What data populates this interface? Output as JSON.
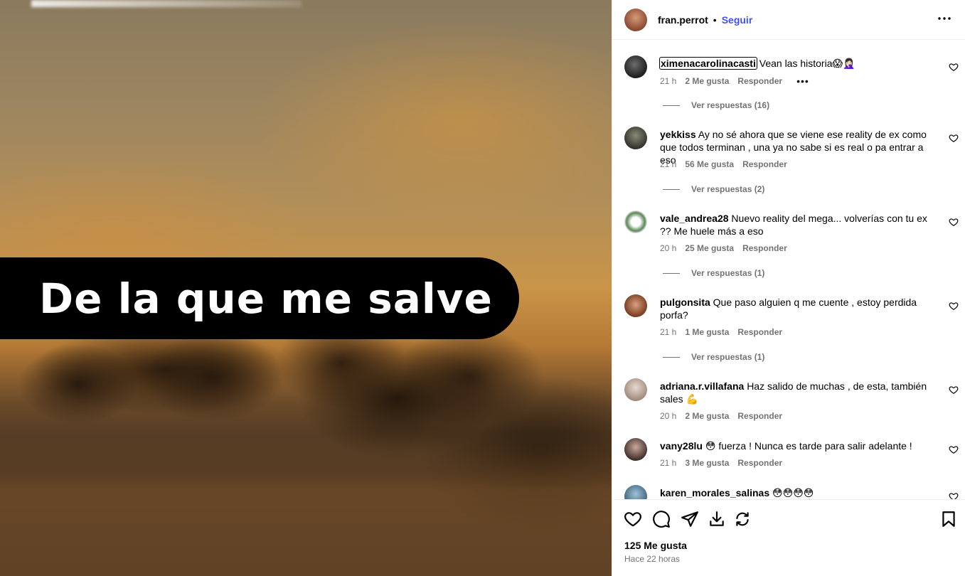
{
  "media": {
    "caption": "De la que me salve"
  },
  "post": {
    "username": "fran.perrot",
    "separator": "•",
    "follow_label": "Seguir",
    "more_label": "•••"
  },
  "comments": [
    {
      "username": "ximenacarolinacasti",
      "text": "Vean las historia😱🤦🏻‍♀️",
      "time": "21 h",
      "likes": "2 Me gusta",
      "reply": "Responder",
      "more": "•••",
      "replies": "Ver respuestas (16)"
    },
    {
      "username": "yekkiss",
      "text": "Ay no sé ahora que se viene ese reality de ex como que todos terminan , una ya no sabe si es real o pa entrar a eso",
      "time": "21 h",
      "likes": "56 Me gusta",
      "reply": "Responder",
      "replies": "Ver respuestas (2)"
    },
    {
      "username": "vale_andrea28",
      "text": "Nuevo reality del mega... volverías con tu ex ?? Me huele más a eso",
      "time": "20 h",
      "likes": "25 Me gusta",
      "reply": "Responder",
      "replies": "Ver respuestas (1)"
    },
    {
      "username": "pulgonsita",
      "text": "Que paso alguien q me cuente , estoy perdida porfa?",
      "time": "21 h",
      "likes": "1 Me gusta",
      "reply": "Responder",
      "replies": "Ver respuestas (1)"
    },
    {
      "username": "adriana.r.villafana",
      "text": "Haz salido de muchas , de esta, también sales 💪",
      "time": "20 h",
      "likes": "2 Me gusta",
      "reply": "Responder"
    },
    {
      "username": "vany28lu",
      "text": "😳 fuerza ! Nunca es tarde para salir adelante !",
      "time": "21 h",
      "likes": "3 Me gusta",
      "reply": "Responder"
    },
    {
      "username": "karen_morales_salinas",
      "text": "😳😳😳😳"
    }
  ],
  "footer": {
    "likes": "125 Me gusta",
    "time_ago": "Hace 22 horas"
  },
  "icons": {
    "like": "heart-icon",
    "comment": "comment-icon",
    "share": "send-icon",
    "download": "download-icon",
    "repost": "repost-icon",
    "save": "bookmark-icon"
  },
  "colors": {
    "follow": "#4150f7",
    "muted": "#737373",
    "caption_bg": "#000000"
  }
}
